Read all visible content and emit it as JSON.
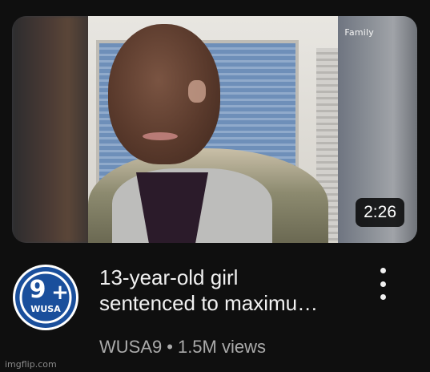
{
  "video": {
    "thumbnail_overlay": "Family",
    "duration": "2:26",
    "title_line1": "13-year-old girl",
    "title_line2": "sentenced to maximu…",
    "channel": "WUSA9",
    "separator": "•",
    "views": "1.5M views"
  },
  "channel_logo": {
    "text": "WUSA",
    "number": "9",
    "plus": "+"
  },
  "watermark": "imgflip.com",
  "colors": {
    "background": "#0f0f0f",
    "title_text": "#f1f1f1",
    "meta_text": "#aaaaaa",
    "logo_blue": "#1a4f9c"
  },
  "icons": {
    "more_menu": "kebab-vertical-icon"
  }
}
